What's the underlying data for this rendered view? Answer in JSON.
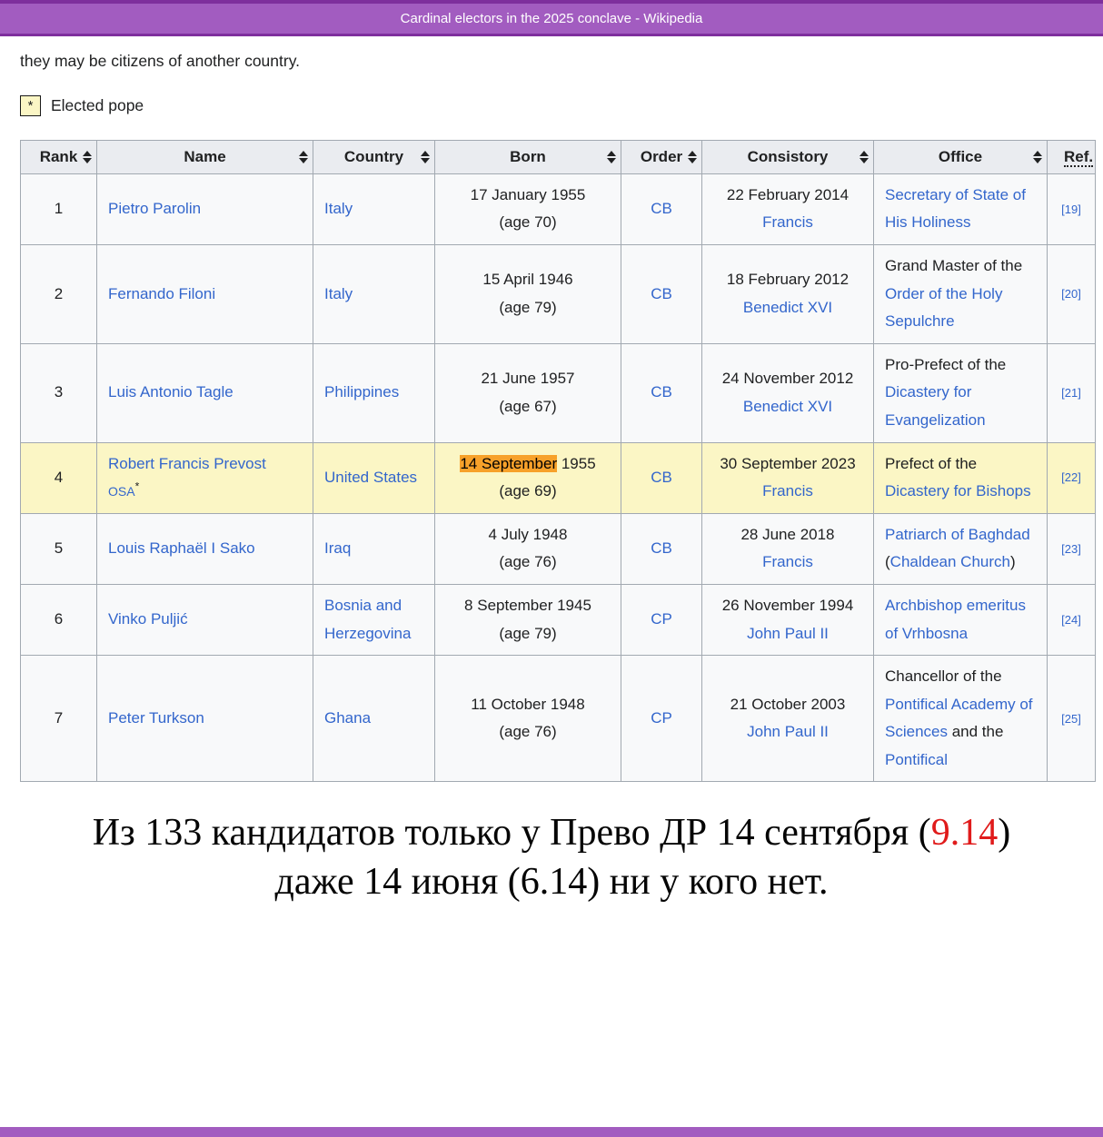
{
  "window": {
    "title": "Cardinal electors in the 2025 conclave - Wikipedia"
  },
  "intro": {
    "text": "they may be citizens of another country."
  },
  "legend": {
    "symbol": "*",
    "label": "Elected pope"
  },
  "colors": {
    "titlebar_purple": "#a25cc0",
    "titlebar_edge": "#7e2f9d",
    "link_blue": "#3366cc",
    "row_highlight_yellow": "#fbf6c5",
    "text_highlight_orange": "#f7a12a",
    "caption_red": "#e01b1b",
    "header_gray": "#eaecf0",
    "table_border": "#a2a9b1"
  },
  "table": {
    "headers": [
      {
        "key": "rank",
        "label": "Rank",
        "sortable": true
      },
      {
        "key": "name",
        "label": "Name",
        "sortable": true
      },
      {
        "key": "country",
        "label": "Country",
        "sortable": true
      },
      {
        "key": "born",
        "label": "Born",
        "sortable": true
      },
      {
        "key": "order",
        "label": "Order",
        "sortable": true
      },
      {
        "key": "consistory",
        "label": "Consistory",
        "sortable": true
      },
      {
        "key": "office",
        "label": "Office",
        "sortable": true
      },
      {
        "key": "ref",
        "label": "Ref.",
        "sortable": false,
        "abbr": true
      }
    ],
    "rows": [
      {
        "highlighted": false,
        "cells": {
          "rank": [
            {
              "t": "1"
            }
          ],
          "name": [
            {
              "t": "Pietro Parolin",
              "link": true
            }
          ],
          "country": [
            {
              "t": "Italy",
              "link": true
            }
          ],
          "born": [
            {
              "t": "17 January 1955"
            },
            {
              "br": true
            },
            {
              "t": "(age 70)"
            }
          ],
          "order": [
            {
              "t": "CB",
              "link": true
            }
          ],
          "consistory": [
            {
              "t": "22 February 2014"
            },
            {
              "br": true
            },
            {
              "t": "Francis",
              "link": true
            }
          ],
          "office": [
            {
              "t": "Secretary of State of His Holiness",
              "link": true
            }
          ],
          "ref": [
            {
              "t": "[19]",
              "link": true
            }
          ]
        }
      },
      {
        "highlighted": false,
        "cells": {
          "rank": [
            {
              "t": "2"
            }
          ],
          "name": [
            {
              "t": "Fernando Filoni",
              "link": true
            }
          ],
          "country": [
            {
              "t": "Italy",
              "link": true
            }
          ],
          "born": [
            {
              "t": "15 April 1946"
            },
            {
              "br": true
            },
            {
              "t": "(age 79)"
            }
          ],
          "order": [
            {
              "t": "CB",
              "link": true
            }
          ],
          "consistory": [
            {
              "t": "18 February 2012"
            },
            {
              "br": true
            },
            {
              "t": "Benedict XVI",
              "link": true
            }
          ],
          "office": [
            {
              "t": "Grand Master of the "
            },
            {
              "t": "Order of the Holy Sepulchre",
              "link": true
            }
          ],
          "ref": [
            {
              "t": "[20]",
              "link": true
            }
          ]
        }
      },
      {
        "highlighted": false,
        "cells": {
          "rank": [
            {
              "t": "3"
            }
          ],
          "name": [
            {
              "t": "Luis Antonio Tagle",
              "link": true
            }
          ],
          "country": [
            {
              "t": "Philippines",
              "link": true
            }
          ],
          "born": [
            {
              "t": "21 June 1957"
            },
            {
              "br": true
            },
            {
              "t": "(age 67)"
            }
          ],
          "order": [
            {
              "t": "CB",
              "link": true
            }
          ],
          "consistory": [
            {
              "t": "24 November 2012"
            },
            {
              "br": true
            },
            {
              "t": "Benedict XVI",
              "link": true
            }
          ],
          "office": [
            {
              "t": "Pro-Prefect of the "
            },
            {
              "t": "Dicastery for Evangelization",
              "link": true
            }
          ],
          "ref": [
            {
              "t": "[21]",
              "link": true
            }
          ]
        }
      },
      {
        "highlighted": true,
        "cells": {
          "rank": [
            {
              "t": "4"
            }
          ],
          "name": [
            {
              "t": "Robert Francis Prevost",
              "link": true
            },
            {
              "br": true
            },
            {
              "t": "OSA",
              "link": true,
              "small": true
            },
            {
              "t": "*",
              "sup": true
            }
          ],
          "country": [
            {
              "t": "United States",
              "link": true
            }
          ],
          "born": [
            {
              "t": "14 September",
              "highlight": true
            },
            {
              "t": " 1955"
            },
            {
              "br": true
            },
            {
              "t": "(age 69)"
            }
          ],
          "order": [
            {
              "t": "CB",
              "link": true
            }
          ],
          "consistory": [
            {
              "t": "30 September 2023"
            },
            {
              "br": true
            },
            {
              "t": "Francis",
              "link": true
            }
          ],
          "office": [
            {
              "t": "Prefect of the "
            },
            {
              "t": "Dicastery for Bishops",
              "link": true
            }
          ],
          "ref": [
            {
              "t": "[22]",
              "link": true
            }
          ]
        }
      },
      {
        "highlighted": false,
        "cells": {
          "rank": [
            {
              "t": "5"
            }
          ],
          "name": [
            {
              "t": "Louis Raphaël I Sako",
              "link": true
            }
          ],
          "country": [
            {
              "t": "Iraq",
              "link": true
            }
          ],
          "born": [
            {
              "t": "4 July 1948"
            },
            {
              "br": true
            },
            {
              "t": "(age 76)"
            }
          ],
          "order": [
            {
              "t": "CB",
              "link": true
            }
          ],
          "consistory": [
            {
              "t": "28 June 2018"
            },
            {
              "br": true
            },
            {
              "t": "Francis",
              "link": true
            }
          ],
          "office": [
            {
              "t": "Patriarch of Baghdad",
              "link": true
            },
            {
              "t": " ("
            },
            {
              "t": "Chaldean Church",
              "link": true
            },
            {
              "t": ")"
            }
          ],
          "ref": [
            {
              "t": "[23]",
              "link": true
            }
          ]
        }
      },
      {
        "highlighted": false,
        "cells": {
          "rank": [
            {
              "t": "6"
            }
          ],
          "name": [
            {
              "t": "Vinko Puljić",
              "link": true
            }
          ],
          "country": [
            {
              "t": "Bosnia and Herzegovina",
              "link": true
            }
          ],
          "born": [
            {
              "t": "8 September 1945"
            },
            {
              "br": true
            },
            {
              "t": "(age 79)"
            }
          ],
          "order": [
            {
              "t": "CP",
              "link": true
            }
          ],
          "consistory": [
            {
              "t": "26 November 1994"
            },
            {
              "br": true
            },
            {
              "t": "John Paul II",
              "link": true
            }
          ],
          "office": [
            {
              "t": "Archbishop emeritus of Vrhbosna",
              "link": true
            }
          ],
          "ref": [
            {
              "t": "[24]",
              "link": true
            }
          ]
        }
      },
      {
        "highlighted": false,
        "cells": {
          "rank": [
            {
              "t": "7"
            }
          ],
          "name": [
            {
              "t": "Peter Turkson",
              "link": true
            }
          ],
          "country": [
            {
              "t": "Ghana",
              "link": true
            }
          ],
          "born": [
            {
              "t": "11 October 1948"
            },
            {
              "br": true
            },
            {
              "t": "(age 76)"
            }
          ],
          "order": [
            {
              "t": "CP",
              "link": true
            }
          ],
          "consistory": [
            {
              "t": "21 October 2003"
            },
            {
              "br": true
            },
            {
              "t": "John Paul II",
              "link": true
            }
          ],
          "office": [
            {
              "t": "Chancellor of the "
            },
            {
              "t": "Pontifical Academy of Sciences",
              "link": true
            },
            {
              "t": " and the "
            },
            {
              "t": "Pontifical",
              "link": true
            }
          ],
          "ref": [
            {
              "t": "[25]",
              "link": true
            }
          ]
        }
      }
    ]
  },
  "caption": {
    "part1": "Из 133 кандидатов только у Прево ДР 14 сентября (",
    "red": "9.14",
    "part2": ")",
    "line2": "даже 14 июня (6.14) ни у кого нет."
  }
}
